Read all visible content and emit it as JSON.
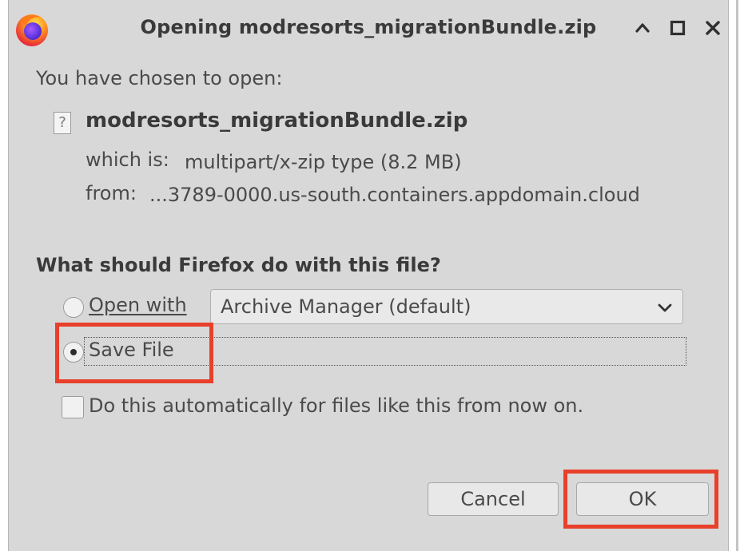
{
  "dialog": {
    "title": "Opening modresorts_migrationBundle.zip",
    "icons": {
      "app": "firefox-logo-icon",
      "minimize": "chevron-up-icon",
      "maximize": "square-icon",
      "close": "close-icon"
    },
    "intro": "You have chosen to open:",
    "file": {
      "name": "modresorts_migrationBundle.zip",
      "icon": "unknown-file-icon",
      "type_label": "which is:",
      "type_value": "multipart/x-zip type (8.2 MB)",
      "from_label": "from:",
      "from_value": "...3789-0000.us-south.containers.appdomain.cloud"
    },
    "question": "What should Firefox do with this file?",
    "options": {
      "open_with": {
        "label": "Open with",
        "selected": false,
        "app": "Archive Manager (default)"
      },
      "save_file": {
        "label": "Save File",
        "selected": true
      }
    },
    "auto": {
      "label": "Do this automatically for files like this from now on.",
      "checked": false
    },
    "buttons": {
      "cancel": "Cancel",
      "ok": "OK"
    },
    "highlight_color": "#e8402a"
  }
}
